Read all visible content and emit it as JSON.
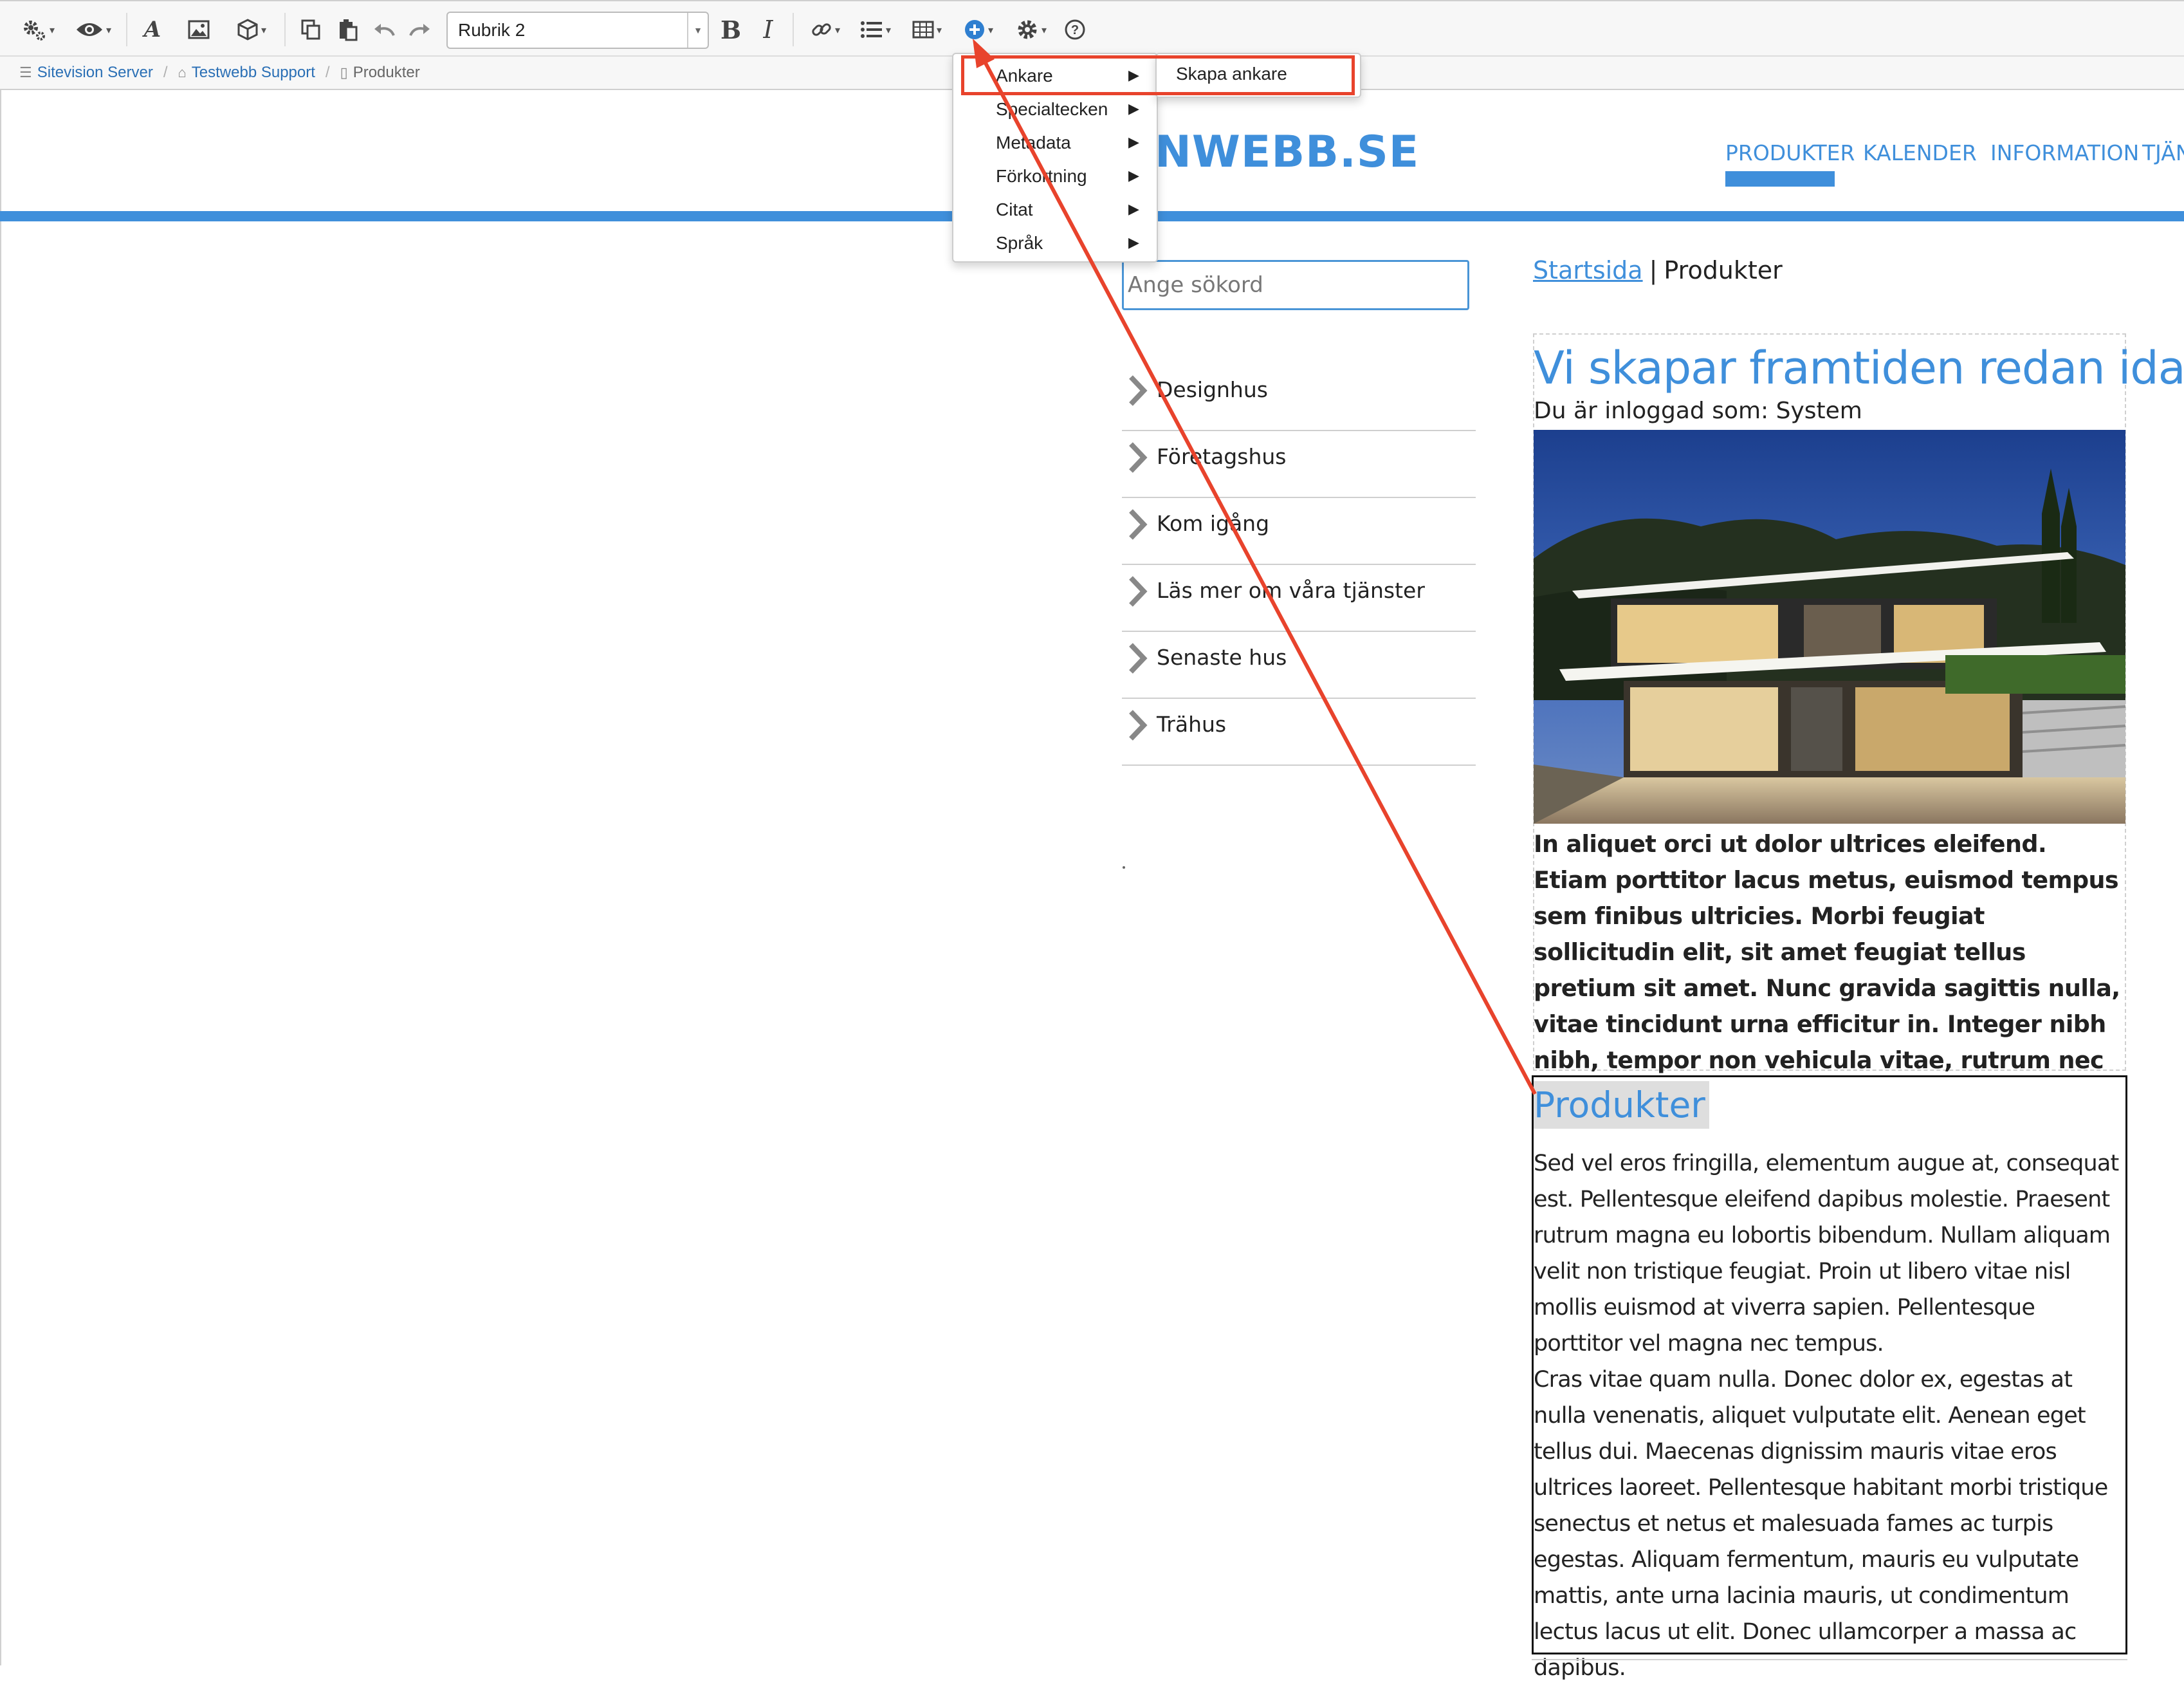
{
  "toolbar": {
    "style_select_value": "Rubrik 2",
    "bold_label": "B",
    "italic_label": "I",
    "font_label": "A"
  },
  "breadcrumb": {
    "items": [
      {
        "label": "Sitevision Server",
        "icon": "server-icon"
      },
      {
        "label": "Testwebb Support",
        "icon": "home-icon"
      },
      {
        "label": "Produkter",
        "icon": "page-icon"
      }
    ]
  },
  "site": {
    "logo": "MINWEBB.SE",
    "nav": [
      "PRODUKTER",
      "KALENDER",
      "INFORMATION",
      "TJÄN"
    ],
    "active_nav": "PRODUKTER",
    "accent_color": "#3f8fdb",
    "search": {
      "placeholder": "Ange sökord"
    },
    "side_menu": [
      "Designhus",
      "Företagshus",
      "Kom igång",
      "Läs mer om våra tjänster",
      "Senaste hus",
      "Trähus"
    ],
    "content_breadcrumb": {
      "link": "Startsida",
      "separator": "|",
      "current": "Produkter"
    },
    "hero_title": "Vi skapar framtiden redan idag",
    "logged_in": "Du är inloggad som: System",
    "intro_text": "In aliquet orci ut dolor ultrices eleifend. Etiam porttitor lacus metus, euismod tempus sem finibus ultricies. Morbi feugiat sollicitudin elit, sit amet feugiat tellus pretium sit amet. Nunc gravida sagittis nulla, vitae tincidunt urna efficitur in. Integer nibh nibh, tempor non vehicula vitae, rutrum nec eros.",
    "section_heading": "Produkter",
    "section_p1": "Sed vel eros fringilla, elementum augue at, consequat est. Pellentesque eleifend dapibus molestie. Praesent rutrum magna eu lobortis bibendum. Nullam aliquam velit non tristique feugiat. Proin ut libero vitae nisl mollis euismod at viverra sapien. Pellentesque porttitor vel magna nec tempus.",
    "section_p2": "Cras vitae quam nulla. Donec dolor ex, egestas at nulla venenatis, aliquet vulputate elit. Aenean eget tellus dui. Maecenas dignissim mauris vitae eros ultrices laoreet. Pellentesque habitant morbi tristique senectus et netus et malesuada fames ac turpis egestas. Aliquam fermentum, mauris eu vulputate mattis, ante urna lacinia mauris, ut condimentum lectus lacus ut elit. Donec ullamcorper a massa ac dapibus."
  },
  "insert_menu": {
    "items": [
      "Ankare",
      "Specialtecken",
      "Metadata",
      "Förkortning",
      "Citat",
      "Språk"
    ],
    "submenu_item": "Skapa ankare"
  },
  "annotation_color": "#e8432c"
}
